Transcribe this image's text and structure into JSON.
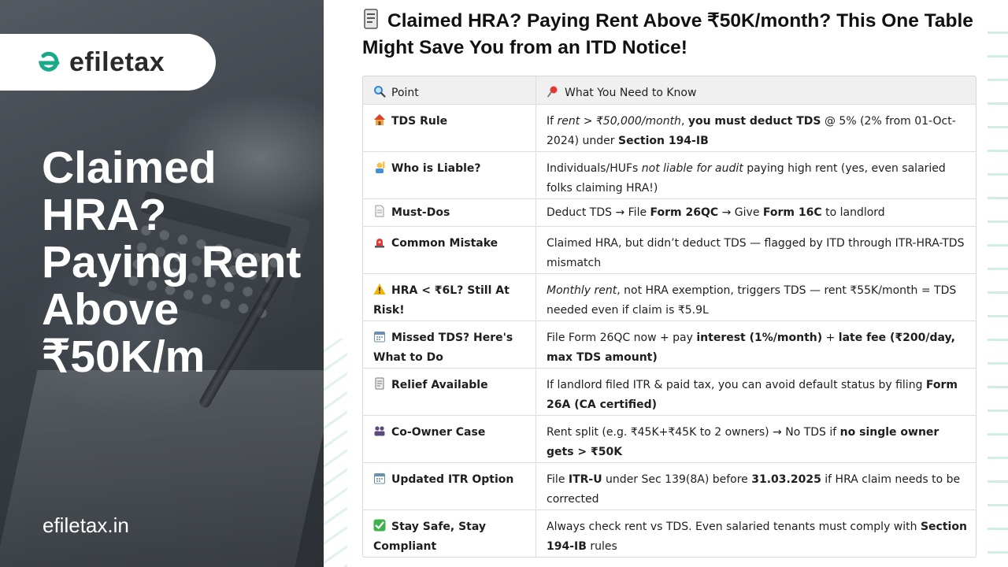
{
  "brand": {
    "logo_text": "efiletax",
    "site": "efiletax.in",
    "accent": "#1aa88a"
  },
  "headline": "Claimed HRA? Paying Rent Above ₹50K/m",
  "title": {
    "icon": "receipt-icon",
    "text": "Claimed HRA? Paying Rent Above ₹50K/month? This One Table Might Save You from an ITD Notice!"
  },
  "table": {
    "headers": [
      {
        "icon": "magnifier-icon",
        "text": "Point"
      },
      {
        "icon": "pushpin-icon",
        "text": "What You Need to Know"
      }
    ],
    "rows": [
      {
        "icon": "house-icon",
        "point": "TDS Rule",
        "t": [
          "If ",
          "rent > ₹50,000/month",
          ", ",
          "you must deduct TDS",
          " @ 5% (2% from 01-Oct-2024) under ",
          "Section 194-IB"
        ]
      },
      {
        "icon": "person-raising-hand-icon",
        "point": "Who is Liable?",
        "t": [
          "Individuals/HUFs ",
          "not liable for audit",
          " paying high rent (yes, even salaried folks claiming HRA!)"
        ]
      },
      {
        "icon": "document-icon",
        "point": "Must-Dos",
        "t": [
          "Deduct TDS → File ",
          "Form 26QC",
          " → Give ",
          "Form 16C",
          " to landlord"
        ]
      },
      {
        "icon": "alarm-light-icon",
        "point": "Common Mistake",
        "t": [
          "Claimed HRA, but didn’t deduct TDS — flagged by ITD through ITR-HRA-TDS mismatch"
        ]
      },
      {
        "icon": "warning-icon",
        "point": "HRA < ₹6L? Still At Risk!",
        "t": [
          "Monthly rent",
          ", not HRA exemption, triggers TDS — rent ₹55K/month = TDS needed even if claim is ₹5.9L"
        ]
      },
      {
        "icon": "calendar-icon",
        "point": "Missed TDS? Here's What to Do",
        "t": [
          "File Form 26QC now + pay ",
          "interest (1%/month)",
          " + ",
          "late fee (₹200/day, max TDS amount)",
          ""
        ]
      },
      {
        "icon": "receipt-icon",
        "point": "Relief Available",
        "t": [
          "If landlord filed ITR & paid tax, you can avoid default status by filing ",
          "Form 26A (CA certified)",
          ""
        ]
      },
      {
        "icon": "people-icon",
        "point": "Co-Owner Case",
        "t": [
          "Rent split (e.g. ₹45K+₹45K to 2 owners) → No TDS if ",
          "no single owner gets > ₹50K",
          ""
        ]
      },
      {
        "icon": "calendar-icon",
        "point": "Updated ITR Option",
        "t": [
          "File ",
          "ITR-U",
          " under Sec 139(8A) before ",
          "31.03.2025",
          " if HRA claim needs to be corrected"
        ]
      },
      {
        "icon": "check-mark-icon",
        "point": "Stay Safe, Stay Compliant",
        "t": [
          "Always check rent vs TDS. Even salaried tenants must comply with ",
          "Section 194-IB",
          " rules"
        ]
      }
    ]
  }
}
